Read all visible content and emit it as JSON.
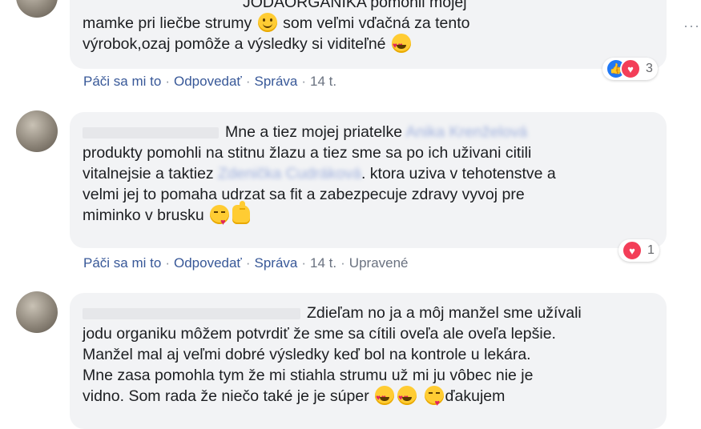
{
  "comments": [
    {
      "lines": [
        "JODAORGANIKA pomohli mojej",
        "mamke pri liečbe strumy",
        "som veľmi vďačná za tento",
        "výrobok,ozaj pomôže a výsledky si viditeľné"
      ],
      "actions": {
        "like": "Páči sa mi to",
        "reply": "Odpovedať",
        "message": "Správa",
        "time": "14 t."
      },
      "reaction_count": "3"
    },
    {
      "lines": [
        "Mne a tiez mojej priatelke",
        "Anika Krenželová",
        "produkty pomohli na stitnu žlazu a tiez sme sa po ich uživani citili",
        "vitalnejsie a taktiez",
        "Zdenička Cudráková",
        ". ktora uziva v tehotenstve a",
        "velmi jej to pomaha udrzat sa fit a zabezpecuje zdravy vyvoj pre",
        "miminko v brusku"
      ],
      "actions": {
        "like": "Páči sa mi to",
        "reply": "Odpovedať",
        "message": "Správa",
        "time": "14 t.",
        "edited": "Upravené"
      },
      "reaction_count": "1"
    },
    {
      "lines": [
        "Zdieľam no ja a môj manžel sme užívali",
        "jodu organiku môžem potvrdiť že sme sa cítili oveľa ale oveľa lepšie.",
        "Manžel mal aj veľmi dobré výsledky keď bol na kontrole u lekára.",
        "Mne zasa pomohla tym že mi stiahla strumu už mi ju vôbec nie je",
        "vidno. Som rada že niečo také je je súper",
        "ďakujem"
      ]
    }
  ],
  "more_options": "···",
  "icons": {
    "smile": "smile-emoji-icon",
    "heart_eyes": "heart-eyes-emoji-icon",
    "kiss": "blowing-kiss-emoji-icon",
    "thumbs_up": "thumbs-up-emoji-icon",
    "like": "like-reaction-icon",
    "love": "love-reaction-icon"
  },
  "colors": {
    "link": "#385898",
    "bubble": "#f2f3f5",
    "like": "#2078f4",
    "love": "#f33e58"
  }
}
